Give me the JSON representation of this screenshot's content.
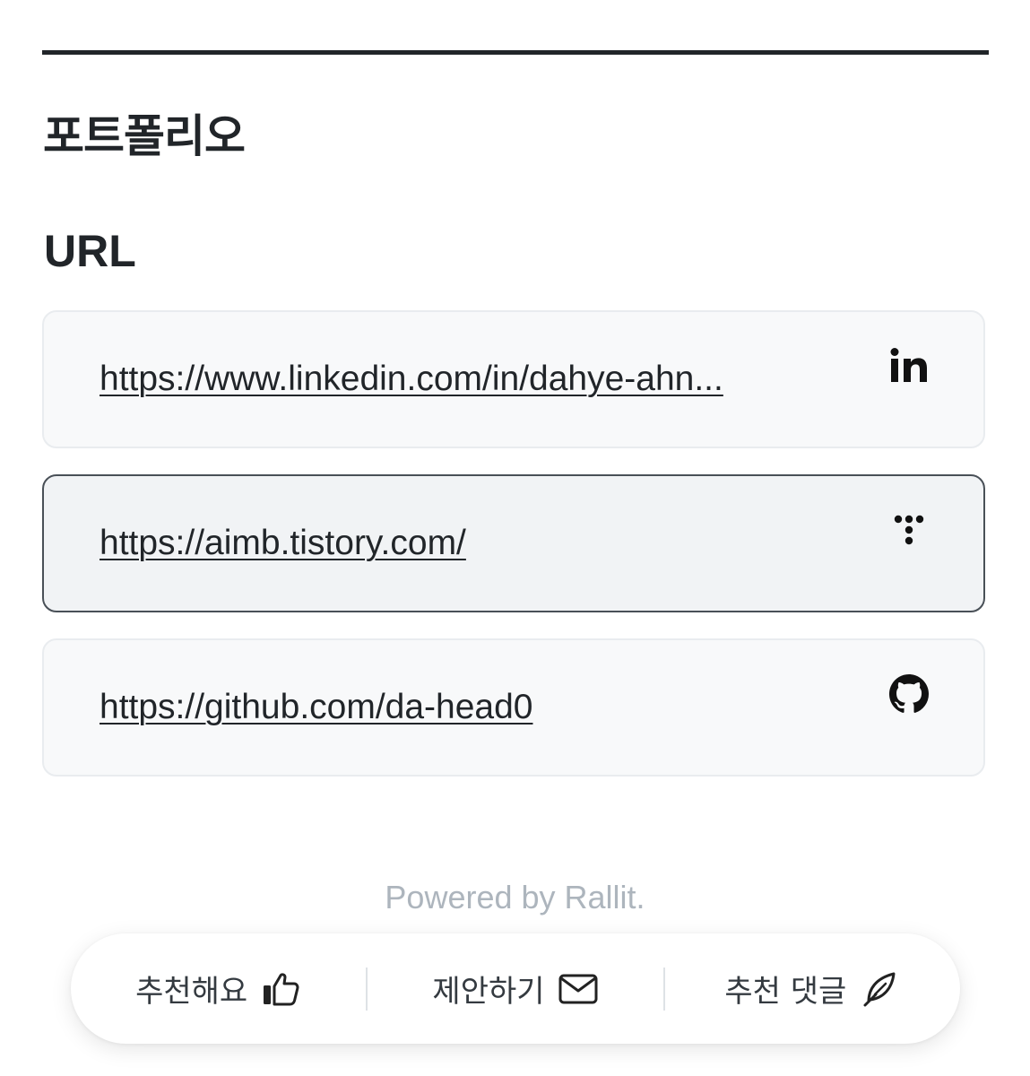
{
  "portfolio": {
    "title": "포트폴리오",
    "url_heading": "URL",
    "links": [
      {
        "url": "https://www.linkedin.com/in/dahye-ahn...",
        "icon": "linkedin-icon"
      },
      {
        "url": "https://aimb.tistory.com/",
        "icon": "tistory-icon"
      },
      {
        "url": "https://github.com/da-head0",
        "icon": "github-icon"
      }
    ]
  },
  "footer": {
    "powered_by": "Powered by Rallit."
  },
  "action_bar": {
    "recommend_label": "추천해요",
    "recommend_icon": "thumbs-up-icon",
    "suggest_label": "제안하기",
    "suggest_icon": "mail-icon",
    "comment_label": "추천 댓글",
    "comment_icon": "feather-pen-icon"
  },
  "colors": {
    "text": "#212529",
    "card_bg": "#f8f9fa",
    "card_border": "#e9ecef",
    "active_border": "#495057",
    "muted": "#adb5bd"
  }
}
